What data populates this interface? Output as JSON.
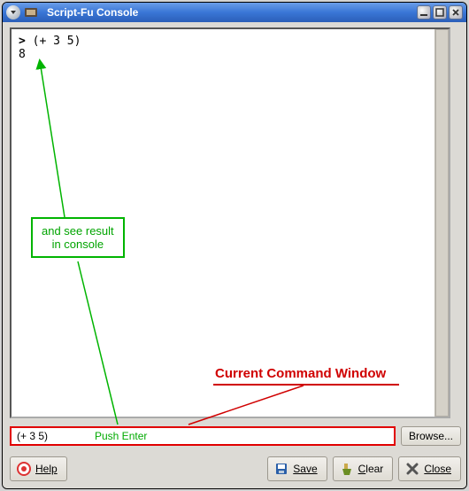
{
  "window": {
    "title": "Script-Fu Console"
  },
  "console": {
    "prompt": ">",
    "input_echo": "(+ 3 5)",
    "result": "8"
  },
  "command": {
    "value": "(+ 3 5)",
    "browse_label": "Browse..."
  },
  "buttons": {
    "help": "Help",
    "save": "Save",
    "clear": "Clear",
    "close": "Close"
  },
  "annotations": {
    "result_note_l1": "and see result",
    "result_note_l2": "in console",
    "push_enter": "Push Enter",
    "cmd_window_label": "Current Command Window"
  },
  "colors": {
    "accent_green": "#00b400",
    "accent_red": "#d00000",
    "titlebar": "#3a76d6"
  }
}
